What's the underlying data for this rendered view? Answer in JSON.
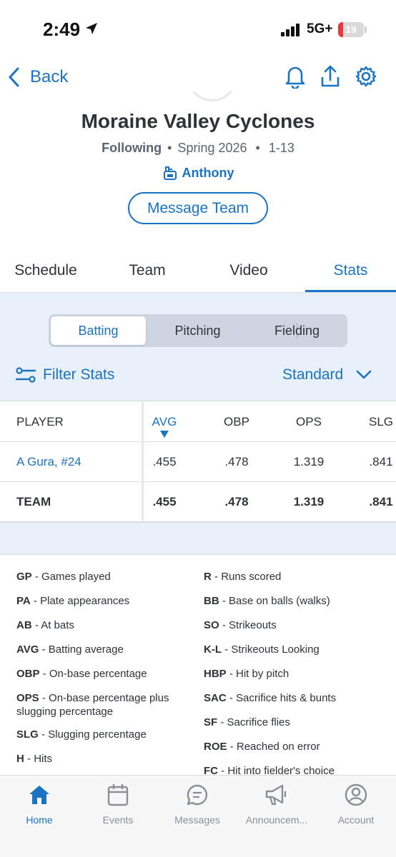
{
  "status": {
    "time": "2:49",
    "network": "5G+",
    "battery": "19",
    "battery_level": 0.19
  },
  "nav": {
    "back_label": "Back"
  },
  "team": {
    "name": "Moraine Valley Cyclones",
    "following": "Following",
    "season": "Spring 2026",
    "record": "1-13",
    "coach": "Anthony",
    "message_button": "Message Team"
  },
  "tabs": [
    {
      "label": "Schedule",
      "active": false
    },
    {
      "label": "Team",
      "active": false
    },
    {
      "label": "Video",
      "active": false
    },
    {
      "label": "Stats",
      "active": true
    }
  ],
  "segments": [
    {
      "label": "Batting",
      "active": true
    },
    {
      "label": "Pitching",
      "active": false
    },
    {
      "label": "Fielding",
      "active": false
    }
  ],
  "filter": {
    "label": "Filter Stats",
    "view": "Standard"
  },
  "table": {
    "columns": [
      "PLAYER",
      "AVG",
      "OBP",
      "OPS",
      "SLG"
    ],
    "sorted_column": "AVG",
    "rows": [
      {
        "player": "A Gura, #24",
        "avg": ".455",
        "obp": ".478",
        "ops": "1.319",
        "slg": ".841"
      }
    ],
    "team_row": {
      "player": "TEAM",
      "avg": ".455",
      "obp": ".478",
      "ops": "1.319",
      "slg": ".841"
    }
  },
  "glossary": {
    "left": [
      {
        "abbr": "GP",
        "desc": "Games played"
      },
      {
        "abbr": "PA",
        "desc": "Plate appearances"
      },
      {
        "abbr": "AB",
        "desc": "At bats"
      },
      {
        "abbr": "AVG",
        "desc": "Batting average"
      },
      {
        "abbr": "OBP",
        "desc": "On-base percentage"
      },
      {
        "abbr": "OPS",
        "desc": "On-base percentage plus slugging percentage"
      },
      {
        "abbr": "SLG",
        "desc": "Slugging percentage"
      },
      {
        "abbr": "H",
        "desc": "Hits"
      }
    ],
    "right": [
      {
        "abbr": "R",
        "desc": "Runs scored"
      },
      {
        "abbr": "BB",
        "desc": "Base on balls (walks)"
      },
      {
        "abbr": "SO",
        "desc": "Strikeouts"
      },
      {
        "abbr": "K-L",
        "desc": "Strikeouts Looking"
      },
      {
        "abbr": "HBP",
        "desc": "Hit by pitch"
      },
      {
        "abbr": "SAC",
        "desc": "Sacrifice hits & bunts"
      },
      {
        "abbr": "SF",
        "desc": "Sacrifice flies"
      },
      {
        "abbr": "ROE",
        "desc": "Reached on error"
      },
      {
        "abbr": "FC",
        "desc": "Hit into fielder's choice"
      }
    ]
  },
  "bottom_nav": [
    {
      "label": "Home",
      "icon": "home-icon",
      "active": true
    },
    {
      "label": "Events",
      "icon": "calendar-icon",
      "active": false
    },
    {
      "label": "Messages",
      "icon": "message-icon",
      "active": false
    },
    {
      "label": "Announcem...",
      "icon": "megaphone-icon",
      "active": false
    },
    {
      "label": "Account",
      "icon": "account-icon",
      "active": false
    }
  ],
  "colors": {
    "accent": "#1a73c4",
    "panel": "#e8f0fa",
    "battery_low": "#e5393f"
  }
}
